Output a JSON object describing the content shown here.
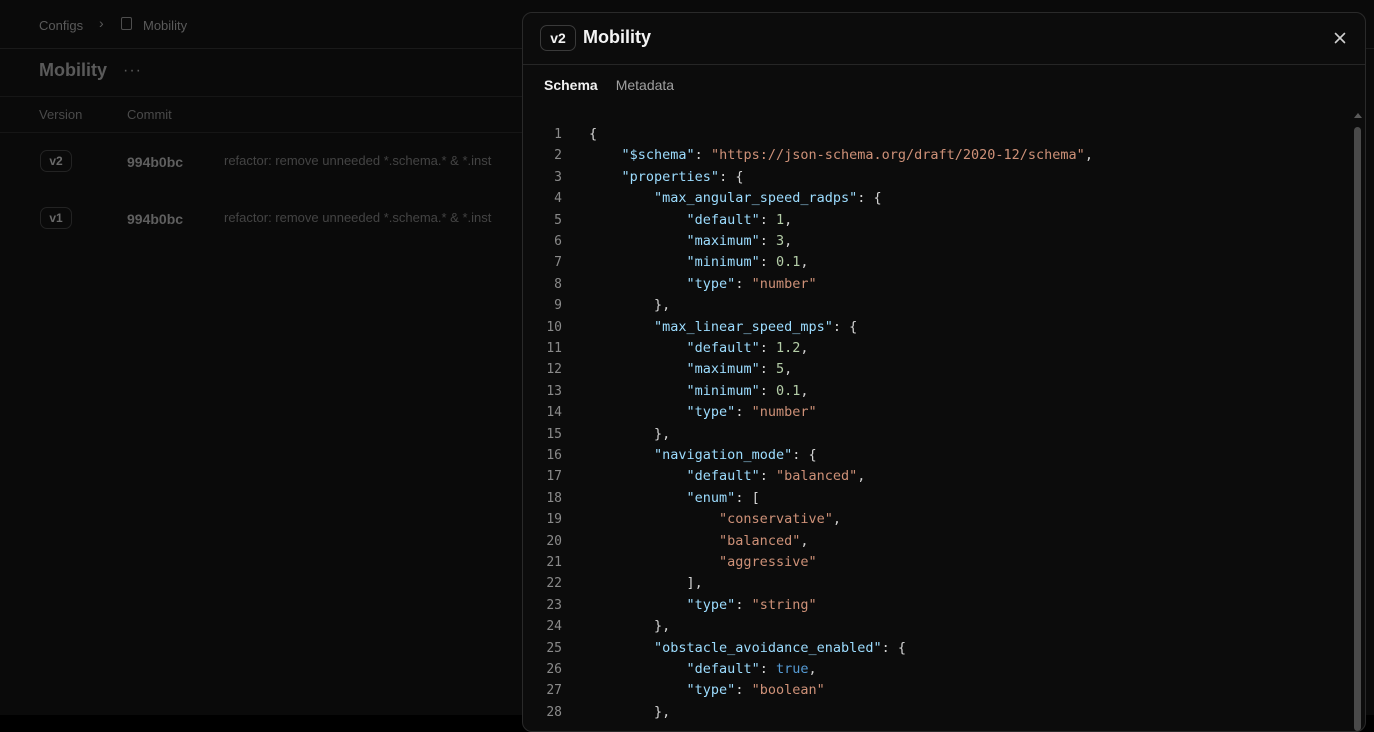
{
  "breadcrumb": {
    "root": "Configs",
    "separator": "›",
    "current": "Mobility"
  },
  "page": {
    "title": "Mobility",
    "more": "···"
  },
  "table": {
    "headers": [
      "Version",
      "Commit"
    ],
    "rows": [
      {
        "version": "v2",
        "commit": "994b0bc",
        "message": "refactor: remove unneeded *.schema.* & *.inst"
      },
      {
        "version": "v1",
        "commit": "994b0bc",
        "message": "refactor: remove unneeded *.schema.* & *.inst"
      }
    ]
  },
  "dialog": {
    "version": "v2",
    "title": "Mobility",
    "tabs": [
      {
        "label": "Schema",
        "active": true
      },
      {
        "label": "Metadata",
        "active": false
      }
    ],
    "code_lines": [
      [
        {
          "t": "{",
          "c": "p"
        }
      ],
      [
        {
          "t": "    ",
          "c": "p"
        },
        {
          "t": "\"$schema\"",
          "c": "k"
        },
        {
          "t": ": ",
          "c": "p"
        },
        {
          "t": "\"https://json-schema.org/draft/2020-12/schema\"",
          "c": "s"
        },
        {
          "t": ",",
          "c": "p"
        }
      ],
      [
        {
          "t": "    ",
          "c": "p"
        },
        {
          "t": "\"properties\"",
          "c": "k"
        },
        {
          "t": ": {",
          "c": "p"
        }
      ],
      [
        {
          "t": "        ",
          "c": "p"
        },
        {
          "t": "\"max_angular_speed_radps\"",
          "c": "k"
        },
        {
          "t": ": {",
          "c": "p"
        }
      ],
      [
        {
          "t": "            ",
          "c": "p"
        },
        {
          "t": "\"default\"",
          "c": "k"
        },
        {
          "t": ": ",
          "c": "p"
        },
        {
          "t": "1",
          "c": "n"
        },
        {
          "t": ",",
          "c": "p"
        }
      ],
      [
        {
          "t": "            ",
          "c": "p"
        },
        {
          "t": "\"maximum\"",
          "c": "k"
        },
        {
          "t": ": ",
          "c": "p"
        },
        {
          "t": "3",
          "c": "n"
        },
        {
          "t": ",",
          "c": "p"
        }
      ],
      [
        {
          "t": "            ",
          "c": "p"
        },
        {
          "t": "\"minimum\"",
          "c": "k"
        },
        {
          "t": ": ",
          "c": "p"
        },
        {
          "t": "0.1",
          "c": "n"
        },
        {
          "t": ",",
          "c": "p"
        }
      ],
      [
        {
          "t": "            ",
          "c": "p"
        },
        {
          "t": "\"type\"",
          "c": "k"
        },
        {
          "t": ": ",
          "c": "p"
        },
        {
          "t": "\"number\"",
          "c": "s"
        }
      ],
      [
        {
          "t": "        },",
          "c": "p"
        }
      ],
      [
        {
          "t": "        ",
          "c": "p"
        },
        {
          "t": "\"max_linear_speed_mps\"",
          "c": "k"
        },
        {
          "t": ": {",
          "c": "p"
        }
      ],
      [
        {
          "t": "            ",
          "c": "p"
        },
        {
          "t": "\"default\"",
          "c": "k"
        },
        {
          "t": ": ",
          "c": "p"
        },
        {
          "t": "1.2",
          "c": "n"
        },
        {
          "t": ",",
          "c": "p"
        }
      ],
      [
        {
          "t": "            ",
          "c": "p"
        },
        {
          "t": "\"maximum\"",
          "c": "k"
        },
        {
          "t": ": ",
          "c": "p"
        },
        {
          "t": "5",
          "c": "n"
        },
        {
          "t": ",",
          "c": "p"
        }
      ],
      [
        {
          "t": "            ",
          "c": "p"
        },
        {
          "t": "\"minimum\"",
          "c": "k"
        },
        {
          "t": ": ",
          "c": "p"
        },
        {
          "t": "0.1",
          "c": "n"
        },
        {
          "t": ",",
          "c": "p"
        }
      ],
      [
        {
          "t": "            ",
          "c": "p"
        },
        {
          "t": "\"type\"",
          "c": "k"
        },
        {
          "t": ": ",
          "c": "p"
        },
        {
          "t": "\"number\"",
          "c": "s"
        }
      ],
      [
        {
          "t": "        },",
          "c": "p"
        }
      ],
      [
        {
          "t": "        ",
          "c": "p"
        },
        {
          "t": "\"navigation_mode\"",
          "c": "k"
        },
        {
          "t": ": {",
          "c": "p"
        }
      ],
      [
        {
          "t": "            ",
          "c": "p"
        },
        {
          "t": "\"default\"",
          "c": "k"
        },
        {
          "t": ": ",
          "c": "p"
        },
        {
          "t": "\"balanced\"",
          "c": "s"
        },
        {
          "t": ",",
          "c": "p"
        }
      ],
      [
        {
          "t": "            ",
          "c": "p"
        },
        {
          "t": "\"enum\"",
          "c": "k"
        },
        {
          "t": ": [",
          "c": "p"
        }
      ],
      [
        {
          "t": "                ",
          "c": "p"
        },
        {
          "t": "\"conservative\"",
          "c": "s"
        },
        {
          "t": ",",
          "c": "p"
        }
      ],
      [
        {
          "t": "                ",
          "c": "p"
        },
        {
          "t": "\"balanced\"",
          "c": "s"
        },
        {
          "t": ",",
          "c": "p"
        }
      ],
      [
        {
          "t": "                ",
          "c": "p"
        },
        {
          "t": "\"aggressive\"",
          "c": "s"
        }
      ],
      [
        {
          "t": "            ],",
          "c": "p"
        }
      ],
      [
        {
          "t": "            ",
          "c": "p"
        },
        {
          "t": "\"type\"",
          "c": "k"
        },
        {
          "t": ": ",
          "c": "p"
        },
        {
          "t": "\"string\"",
          "c": "s"
        }
      ],
      [
        {
          "t": "        },",
          "c": "p"
        }
      ],
      [
        {
          "t": "        ",
          "c": "p"
        },
        {
          "t": "\"obstacle_avoidance_enabled\"",
          "c": "k"
        },
        {
          "t": ": {",
          "c": "p"
        }
      ],
      [
        {
          "t": "            ",
          "c": "p"
        },
        {
          "t": "\"default\"",
          "c": "k"
        },
        {
          "t": ": ",
          "c": "p"
        },
        {
          "t": "true",
          "c": "b"
        },
        {
          "t": ",",
          "c": "p"
        }
      ],
      [
        {
          "t": "            ",
          "c": "p"
        },
        {
          "t": "\"type\"",
          "c": "k"
        },
        {
          "t": ": ",
          "c": "p"
        },
        {
          "t": "\"boolean\"",
          "c": "s"
        }
      ],
      [
        {
          "t": "        },",
          "c": "p"
        }
      ]
    ]
  },
  "colors": {
    "key": "#9cdcfe",
    "string": "#ce9178",
    "number": "#b5cea8",
    "boolean": "#569cd6"
  }
}
